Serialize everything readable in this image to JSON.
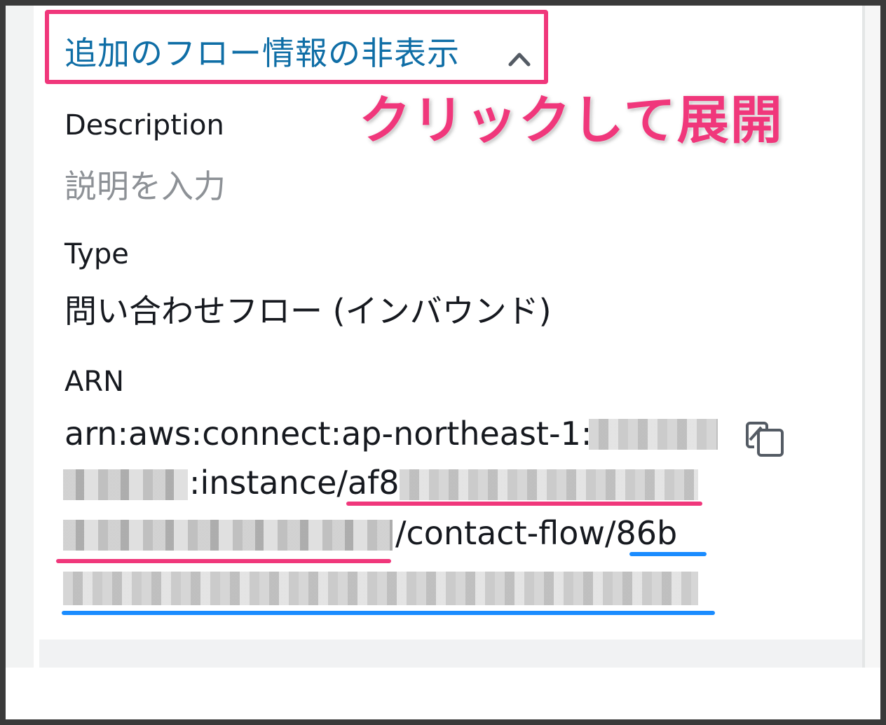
{
  "toggle": {
    "label": "追加のフロー情報の非表示",
    "icon": "chevron-up-icon",
    "link_color": "#0f6ea6"
  },
  "annotation": {
    "text": "クリックして展開",
    "color": "#f0377b"
  },
  "fields": {
    "description": {
      "label": "Description",
      "placeholder": "説明を入力"
    },
    "type": {
      "label": "Type",
      "value": "問い合わせフロー (インバウンド)"
    },
    "arn": {
      "label": "ARN",
      "line1": "arn:aws:connect:ap-northeast-1:",
      "line2_text": ":instance/",
      "line2_highlight": "af8",
      "line3_text": "/contact-flow/",
      "line3_highlight": "86b",
      "copy_icon": "copy-icon"
    }
  },
  "highlight_colors": {
    "instance_id": "#f0377b",
    "flow_id": "#1a8cff"
  }
}
